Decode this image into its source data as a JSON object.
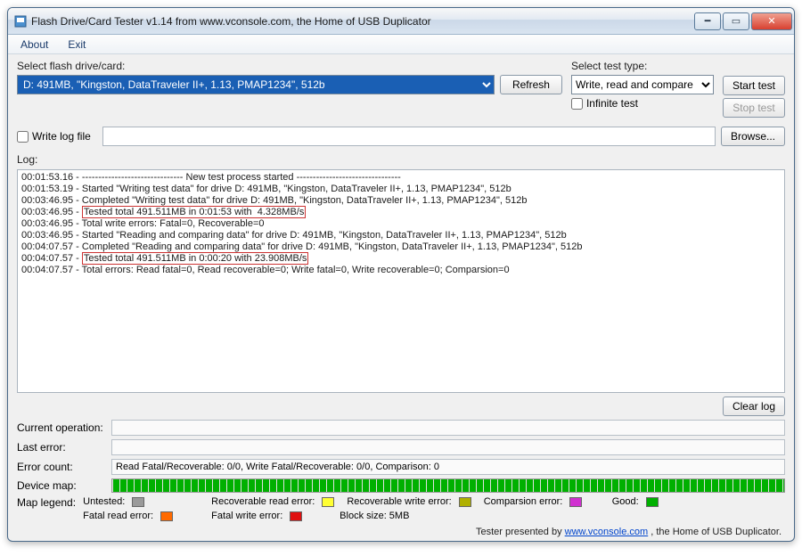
{
  "window": {
    "title": "Flash Drive/Card Tester v1.14 from www.vconsole.com, the Home of USB Duplicator"
  },
  "menu": {
    "about": "About",
    "exit": "Exit"
  },
  "labels": {
    "select_drive": "Select flash drive/card:",
    "select_test": "Select test type:",
    "refresh": "Refresh",
    "start": "Start test",
    "stop": "Stop test",
    "infinite": "Infinite test",
    "writelog": "Write log file",
    "browse": "Browse...",
    "log": "Log:",
    "clearlog": "Clear log",
    "currentop": "Current operation:",
    "lasterr": "Last error:",
    "errcount": "Error count:",
    "devmap": "Device map:",
    "maplegend": "Map legend:"
  },
  "drive_selected": "D: 491MB, \"Kingston, DataTraveler II+, 1.13, PMAP1234\", 512b",
  "test_type_selected": "Write, read and compare",
  "log_lines": [
    {
      "t": "00:01:53.16",
      "txt": "------------------------------- New test process started --------------------------------",
      "hl": false
    },
    {
      "t": "00:01:53.19",
      "txt": "Started \"Writing test data\" for drive D: 491MB, \"Kingston, DataTraveler II+, 1.13, PMAP1234\", 512b",
      "hl": false
    },
    {
      "t": "00:03:46.95",
      "txt": "Completed \"Writing test data\" for drive D: 491MB, \"Kingston, DataTraveler II+, 1.13, PMAP1234\", 512b",
      "hl": false
    },
    {
      "t": "00:03:46.95",
      "txt": "Tested total 491.511MB in 0:01:53 with  4.328MB/s",
      "hl": true
    },
    {
      "t": "00:03:46.95",
      "txt": "Total write errors: Fatal=0, Recoverable=0",
      "hl": false
    },
    {
      "t": "00:03:46.95",
      "txt": "Started \"Reading and comparing data\" for drive D: 491MB, \"Kingston, DataTraveler II+, 1.13, PMAP1234\", 512b",
      "hl": false
    },
    {
      "t": "00:04:07.57",
      "txt": "Completed \"Reading and comparing data\" for drive D: 491MB, \"Kingston, DataTraveler II+, 1.13, PMAP1234\", 512b",
      "hl": false
    },
    {
      "t": "00:04:07.57",
      "txt": "Tested total 491.511MB in 0:00:20 with 23.908MB/s",
      "hl": true
    },
    {
      "t": "00:04:07.57",
      "txt": "Total errors: Read fatal=0, Read recoverable=0; Write fatal=0, Write recoverable=0; Comparsion=0",
      "hl": false
    }
  ],
  "status": {
    "current_op": "",
    "last_error": "",
    "error_count": "Read Fatal/Recoverable: 0/0, Write Fatal/Recoverable: 0/0, Comparison: 0"
  },
  "legend": {
    "untested": {
      "label": "Untested:",
      "color": "#9a9a9a"
    },
    "recov_read": {
      "label": "Recoverable read error:",
      "color": "#ffff33"
    },
    "recov_write": {
      "label": "Recoverable write error:",
      "color": "#b0b000"
    },
    "comparison": {
      "label": "Comparsion error:",
      "color": "#d030d0"
    },
    "good": {
      "label": "Good:",
      "color": "#00b000"
    },
    "fatal_read": {
      "label": "Fatal read error:",
      "color": "#ff6a00"
    },
    "fatal_write": {
      "label": "Fatal write error:",
      "color": "#e01010"
    },
    "block_size": {
      "label": "Block size: 5MB"
    }
  },
  "footer": {
    "prefix": "Tester presented by ",
    "link": "www.vconsole.com",
    "suffix": " , the Home of USB Duplicator."
  }
}
